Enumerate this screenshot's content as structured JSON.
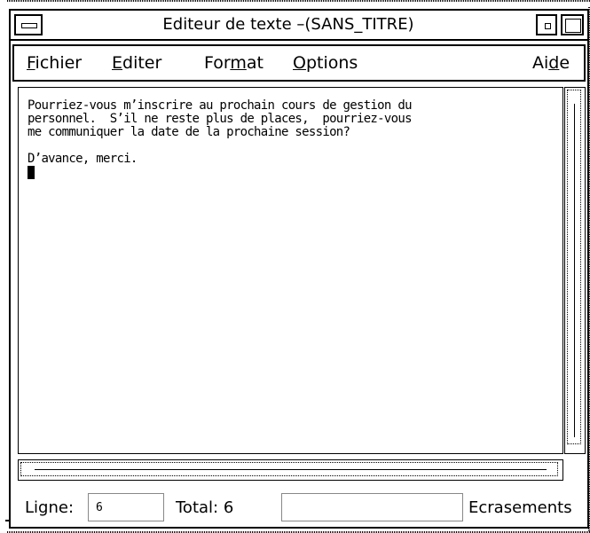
{
  "window": {
    "title": "Editeur de texte –(SANS_TITRE)"
  },
  "menubar": {
    "items": [
      {
        "pre": "",
        "ul": "F",
        "post": "ichier"
      },
      {
        "pre": "",
        "ul": "E",
        "post": "diter"
      },
      {
        "pre": "For",
        "ul": "m",
        "post": "at"
      },
      {
        "pre": "",
        "ul": "O",
        "post": "ptions"
      },
      {
        "pre": "Ai",
        "ul": "d",
        "post": "e"
      }
    ]
  },
  "editor": {
    "text": "Pourriez-vous m’inscrire au prochain cours de gestion du\npersonnel.  S’il ne reste plus de places,  pourriez-vous\nme communiquer la date de la prochaine session?\n\nD’avance, merci.\n"
  },
  "footer": {
    "line_label": "Ligne:",
    "line_value": "6",
    "total_label": "Total: 6",
    "overwrite_value": "",
    "mode_label": "Ecrasements"
  },
  "icons": {
    "window_menu": "window-menu-icon",
    "minimize": "minimize-icon",
    "maximize": "maximize-icon"
  }
}
